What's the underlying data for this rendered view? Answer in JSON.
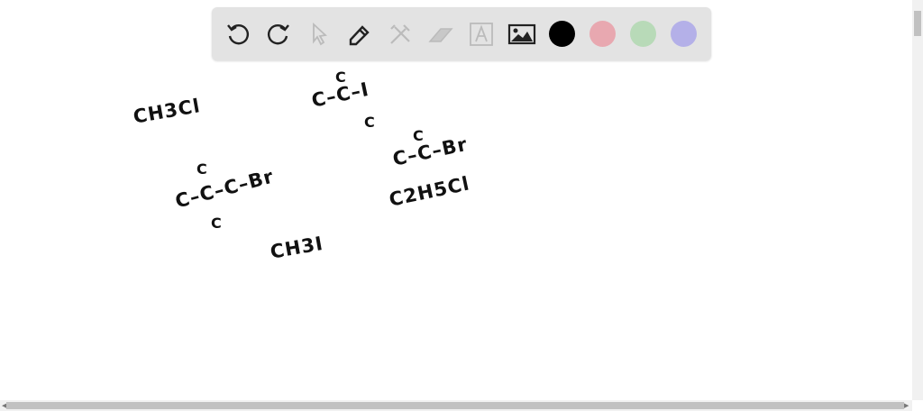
{
  "toolbar": {
    "tools": [
      "undo-icon",
      "redo-icon",
      "select-icon",
      "pen-icon",
      "tools-icon",
      "eraser-icon",
      "text-icon",
      "image-icon"
    ],
    "colors": {
      "black": "#000000",
      "pink": "#e8a8b0",
      "green": "#b8dab8",
      "purple": "#b4b0e8"
    }
  },
  "canvas": {
    "items": [
      {
        "text": "CH3Cl"
      },
      {
        "text": "C"
      },
      {
        "text": "C–C–I"
      },
      {
        "text": "C"
      },
      {
        "text": "C"
      },
      {
        "text": "C–C–Br"
      },
      {
        "text": "C–C–C–Br"
      },
      {
        "text": "C"
      },
      {
        "text": "C"
      },
      {
        "text": "C2H5Cl"
      },
      {
        "text": "CH3I"
      }
    ]
  }
}
